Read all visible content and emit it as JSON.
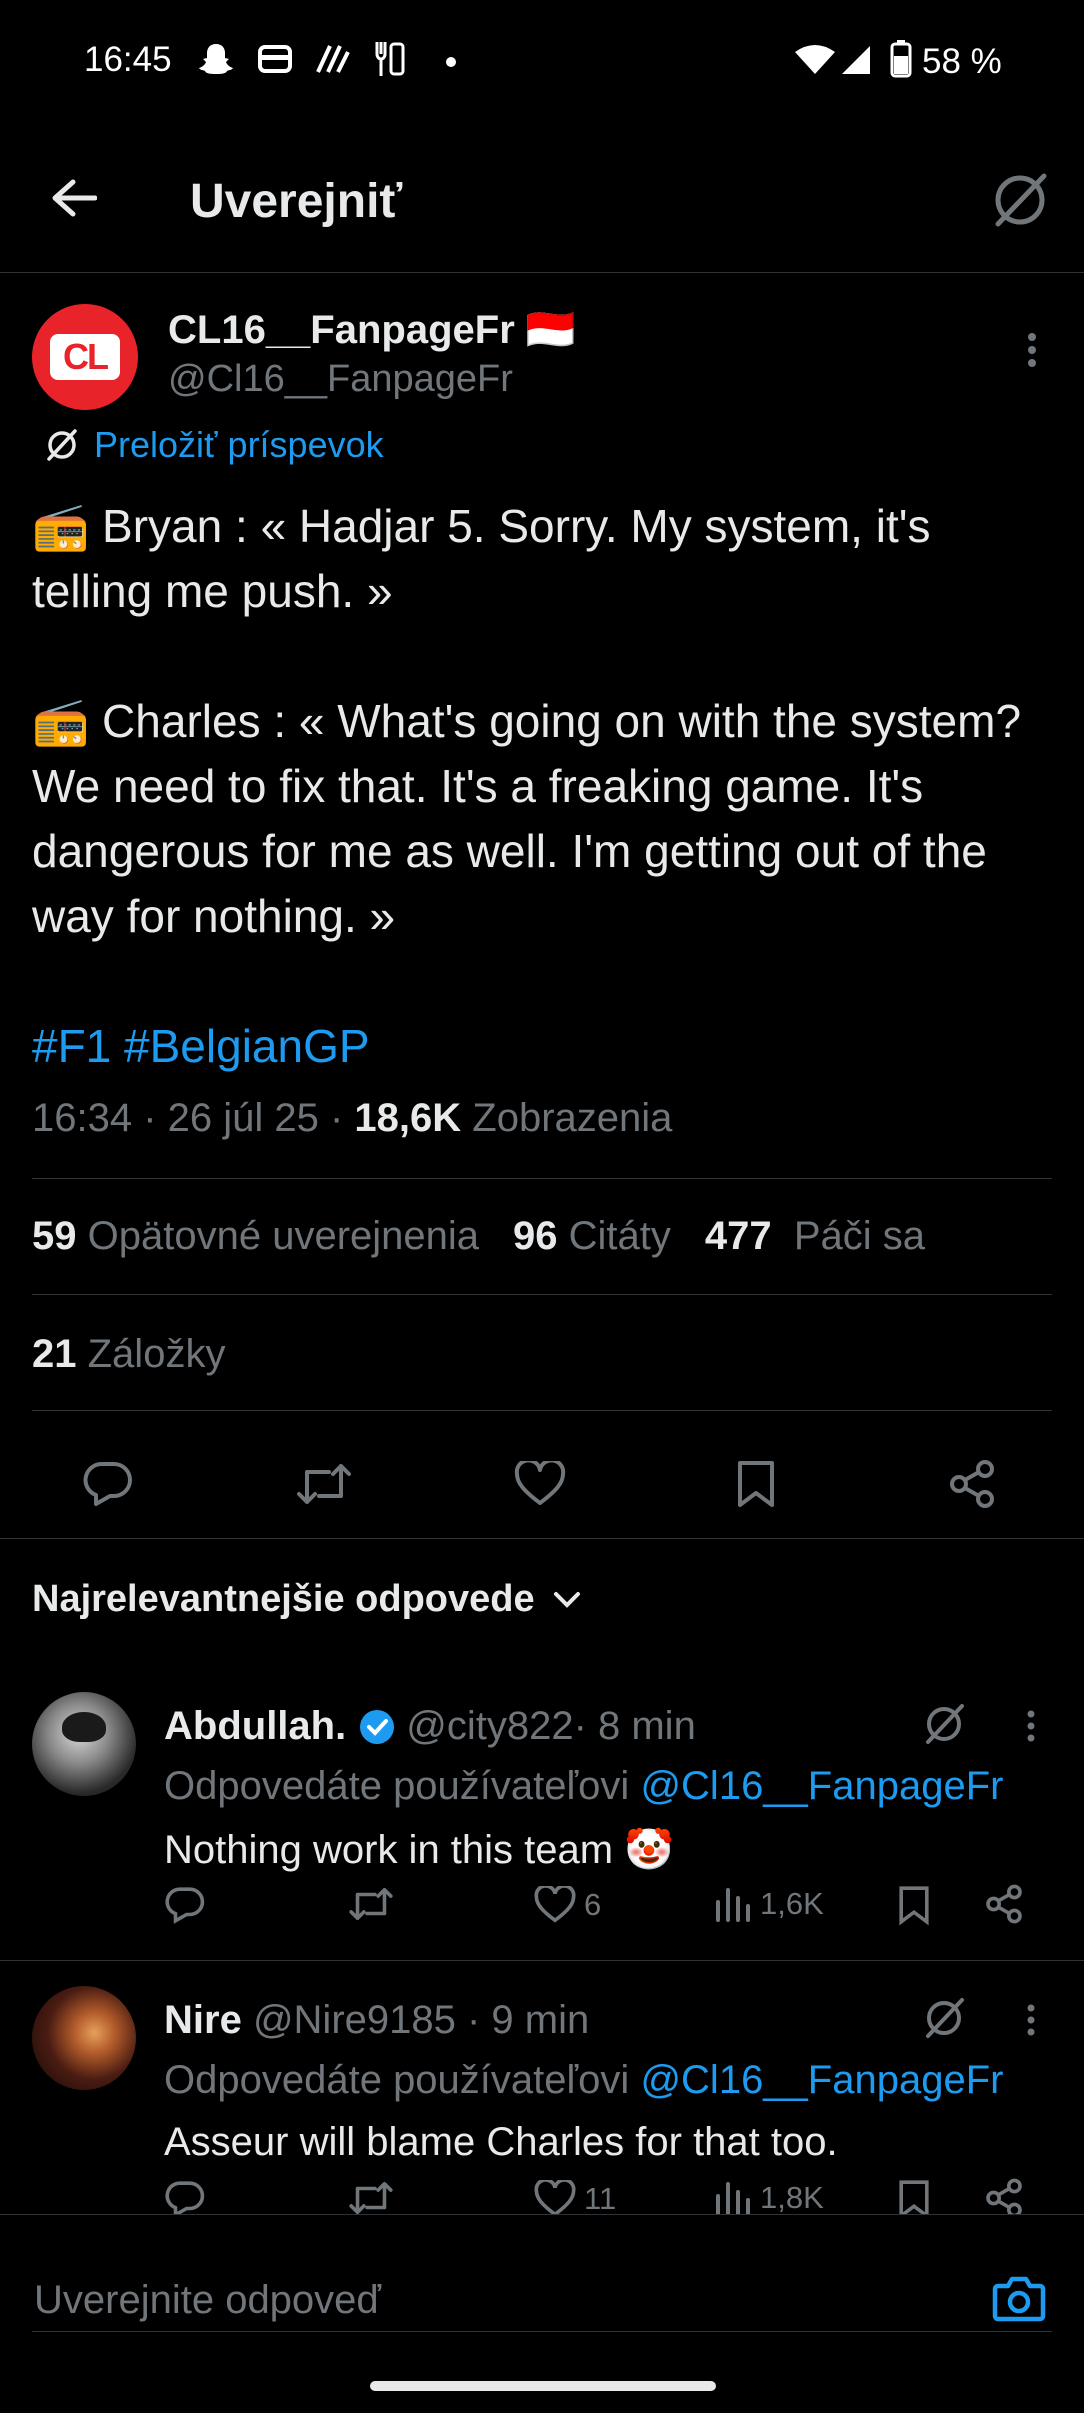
{
  "status_bar": {
    "time": "16:45",
    "battery": "58 %"
  },
  "header": {
    "title": "Uverejniť"
  },
  "post": {
    "display_name": "CL16__FanpageFr",
    "flag": "🇮🇩",
    "handle": "@Cl16__FanpageFr",
    "avatar_text": "CL",
    "translate_label": "Preložiť príspevok",
    "paragraph1": "📻 Bryan : « Hadjar 5. Sorry. My system, it's telling me push. »",
    "paragraph2": "📻 Charles : « What's going on with the system? We need to fix that. It's a freaking game. It's dangerous for me as well. I'm getting out of the way for nothing. »",
    "hashtags": "#F1 #BelgianGP",
    "timestamp": "16:34 · 26 júl 25 · ",
    "views_count": "18,6K",
    "views_label": " Zobrazenia",
    "reposts_count": "59",
    "reposts_label": "Opätovné uverejnenia",
    "quotes_count": "96",
    "quotes_label": "Citáty",
    "likes_count": "477",
    "likes_label": "Páči sa",
    "bookmarks_count": "21",
    "bookmarks_label": "Záložky"
  },
  "replies_section": {
    "sort_label": "Najrelevantnejšie odpovede"
  },
  "replies": [
    {
      "name": "Abdullah.",
      "handle": "@city822",
      "time": " · 8 min",
      "replying_prefix": "Odpovedáte používateľovi ",
      "replying_to": "@Cl16__FanpageFr",
      "text": "Nothing work in this team 🤡",
      "likes": "6",
      "views": "1,6K"
    },
    {
      "name": "Nire",
      "handle": "@Nire9185",
      "time": " · 9 min",
      "replying_prefix": "Odpovedáte používateľovi ",
      "replying_to": "@Cl16__FanpageFr",
      "text": "Asseur will blame Charles for that too.",
      "likes": "11",
      "views": "1,8K"
    }
  ],
  "compose": {
    "placeholder": "Uverejnite odpoveď"
  },
  "colors": {
    "background": "#000000",
    "text": "#e7e9ea",
    "muted": "#71767b",
    "accent": "#1d9bf0",
    "avatar_red": "#e8232a",
    "verified": "#1d9bf0"
  }
}
